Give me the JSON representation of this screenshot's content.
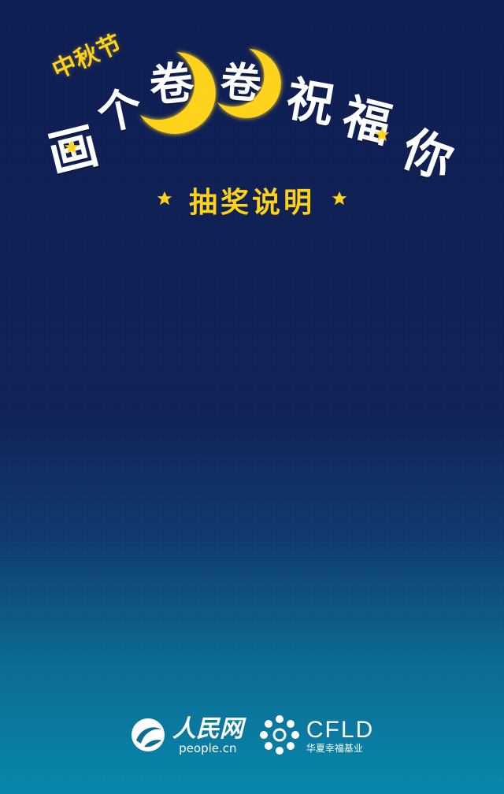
{
  "header": {
    "small_title": "中秋节",
    "title_chars": [
      "画",
      "个",
      "卷",
      "卷",
      "祝",
      "福",
      "你"
    ],
    "subtitle": "抽奖说明"
  },
  "footer": {
    "people_daily": {
      "name": "人民网",
      "url": "people.cn",
      "icon": "people-daily-logo"
    },
    "cfld": {
      "name": "CFLD",
      "sub": "华夏幸福基业",
      "icon": "cfld-dots-logo"
    }
  },
  "colors": {
    "accent": "#ffd21a",
    "title_text": "#ffffff",
    "bg_top": "#0d1d52",
    "bg_bottom": "#0686ab"
  }
}
